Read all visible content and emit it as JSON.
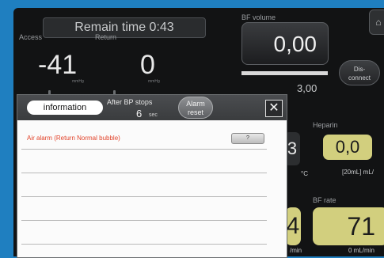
{
  "header": {
    "remain_time": "Remain time 0:43"
  },
  "pressures": {
    "access_label": "Access",
    "access_value": "-41",
    "return_label": "Return",
    "return_value": "0",
    "access_unit": "mmHg",
    "return_unit": "mmHg"
  },
  "bf_volume": {
    "label": "BF volume",
    "value": "0,00",
    "target": "3,00"
  },
  "disconnect": {
    "label_line1": "Dis-",
    "label_line2": "connect"
  },
  "heparin": {
    "label": "Heparin",
    "value": "0,0",
    "unit": "[20mL] mL/"
  },
  "temperature": {
    "value": "3",
    "unit": "°C"
  },
  "bf_rate": {
    "label": "BF rate",
    "value": "71",
    "unit": "0 mL/min",
    "left_value": "4",
    "left_unit": "/min"
  },
  "dialog": {
    "info_button": "information",
    "after_bp_label": "After BP stops",
    "after_bp_value": "6",
    "after_bp_unit": "sec",
    "alarm_reset_line1": "Alarm",
    "alarm_reset_line2": "reset",
    "close": "✕",
    "alarm_message": "Air alarm (Return Normal bubble)",
    "alarm_detail_button": "?"
  },
  "icons": {
    "home": "home-icon",
    "close": "close-icon"
  },
  "colors": {
    "accent_yellow": "#d2cf7e",
    "alarm_red": "#e2432a",
    "frame_border": "#1f7fc0"
  }
}
